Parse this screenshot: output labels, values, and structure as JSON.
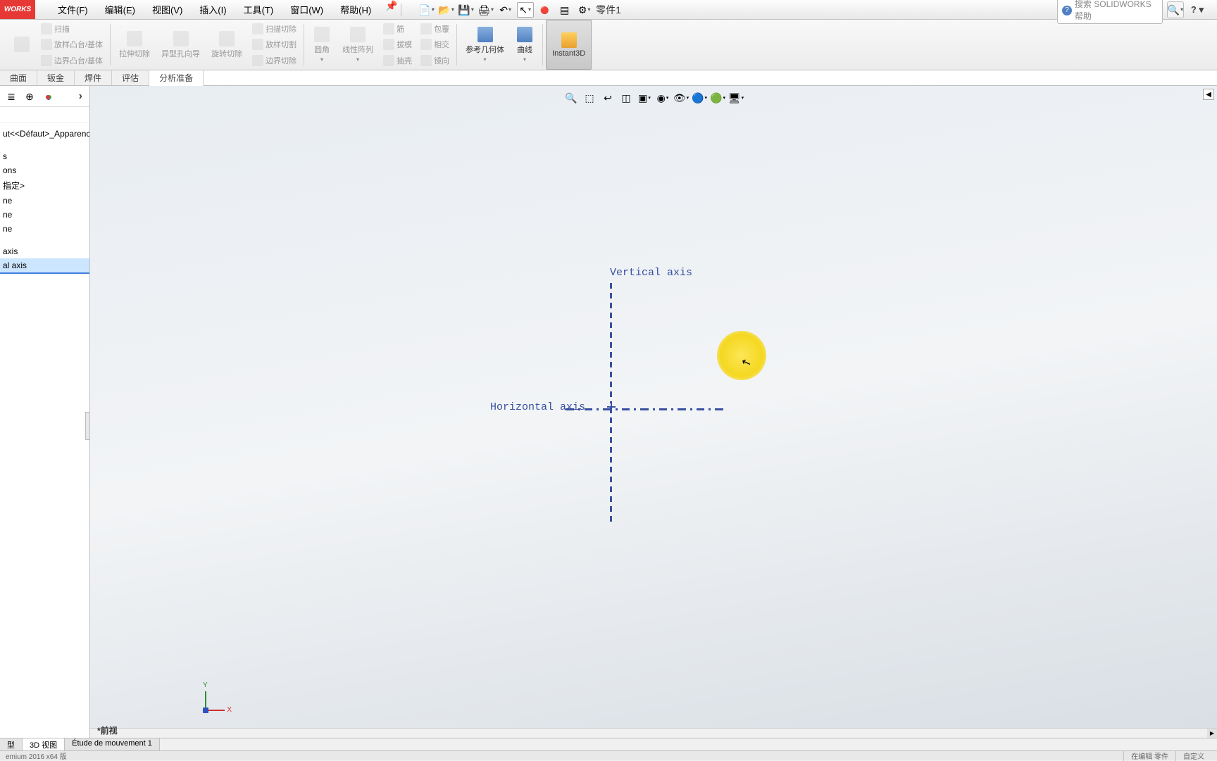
{
  "app": {
    "logo_text": "WORKS",
    "doc_title": "零件1"
  },
  "menu": {
    "file": "文件(F)",
    "edit": "编辑(E)",
    "view": "视图(V)",
    "insert": "插入(I)",
    "tools": "工具(T)",
    "window": "窗口(W)",
    "help": "帮助(H)"
  },
  "search": {
    "placeholder": "搜索 SOLIDWORKS 帮助"
  },
  "ribbon": {
    "sweep": "扫描",
    "loft_boss": "放样凸台/基体",
    "boundary_boss": "边界凸台/基体",
    "extrude_cut": "拉伸切除",
    "hole_wizard": "异型孔向导",
    "revolve_cut": "旋转切除",
    "sweep_cut": "扫描切除",
    "loft_cut": "放样切割",
    "boundary_cut": "边界切除",
    "fillet": "圆角",
    "linear_pattern": "线性阵列",
    "rib": "筋",
    "draft": "拔模",
    "shell": "抽壳",
    "wrap": "包覆",
    "intersect": "相交",
    "mirror": "镜向",
    "ref_geom": "参考几何体",
    "curves": "曲线",
    "instant3d": "Instant3D"
  },
  "tabs": {
    "surface": "曲面",
    "sheetmetal": "钣金",
    "weldment": "焊件",
    "evaluate": "评估",
    "analysis_prep": "分析准备"
  },
  "tree": {
    "root": "ut<<Défaut>_Apparence Ef",
    "items": [
      "s",
      "ons",
      "指定>",
      "ne",
      "ne",
      "ne",
      "axis",
      "al axis"
    ]
  },
  "viewport": {
    "vertical_axis": "Vertical axis",
    "horizontal_axis": "Horizontal axis",
    "orientation": "*前视"
  },
  "bottom_tabs": {
    "model": "型",
    "view3d": "3D 视图",
    "motion": "Étude de mouvement 1"
  },
  "status": {
    "version": "emium 2016 x64 版",
    "editing": "在编辑 零件",
    "custom": "自定义"
  }
}
